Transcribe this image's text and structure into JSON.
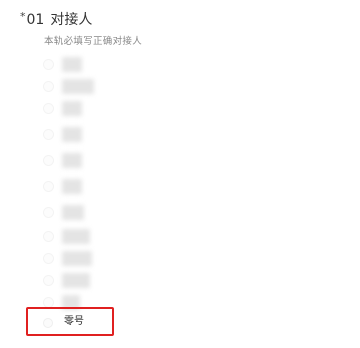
{
  "question": {
    "required_mark": "*",
    "number": "01",
    "title": "对接人",
    "hint": "本轨必填写正确对接人"
  },
  "options": [
    {
      "label": "",
      "blurred": true
    },
    {
      "label": "",
      "blurred": true
    },
    {
      "label": "",
      "blurred": true
    },
    {
      "label": "",
      "blurred": true
    },
    {
      "label": "",
      "blurred": true
    },
    {
      "label": "",
      "blurred": true
    },
    {
      "label": "",
      "blurred": true
    },
    {
      "label": "",
      "blurred": true
    },
    {
      "label": "",
      "blurred": true
    },
    {
      "label": "",
      "blurred": true
    },
    {
      "label": "",
      "blurred": true
    }
  ],
  "highlighted_option": {
    "label": "零号"
  },
  "colors": {
    "highlight_border": "#e02020",
    "blur_placeholder": "#e4e4e4"
  }
}
